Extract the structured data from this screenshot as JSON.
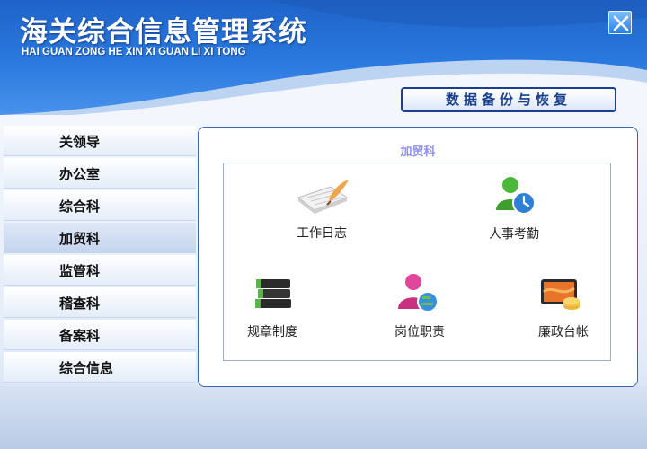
{
  "header": {
    "title": "海关综合信息管理系统",
    "subtitle": "HAI GUAN ZONG HE XIN XI GUAN LI XI TONG",
    "close_icon": "close-icon",
    "backup_button": "数据备份与恢复"
  },
  "sidebar": {
    "items": [
      {
        "label": "关领导"
      },
      {
        "label": "办公室"
      },
      {
        "label": "综合科"
      },
      {
        "label": "加贸科"
      },
      {
        "label": "监管科"
      },
      {
        "label": "稽查科"
      },
      {
        "label": "备案科"
      },
      {
        "label": "综合信息"
      }
    ],
    "active": "加贸科"
  },
  "panel": {
    "title": "加贸科",
    "modules": [
      {
        "label": "工作日志",
        "icon": "notebook-quill-icon"
      },
      {
        "label": "人事考勤",
        "icon": "user-clock-icon"
      },
      {
        "label": "规章制度",
        "icon": "book-stack-icon"
      },
      {
        "label": "岗位职责",
        "icon": "user-globe-icon"
      },
      {
        "label": "廉政台帐",
        "icon": "monitor-coins-icon"
      }
    ]
  },
  "colors": {
    "header_blue": "#2a7ae0",
    "panel_border": "#3d64b0",
    "panel_title": "#8f8ff0",
    "button_text": "#1a3f8c"
  }
}
